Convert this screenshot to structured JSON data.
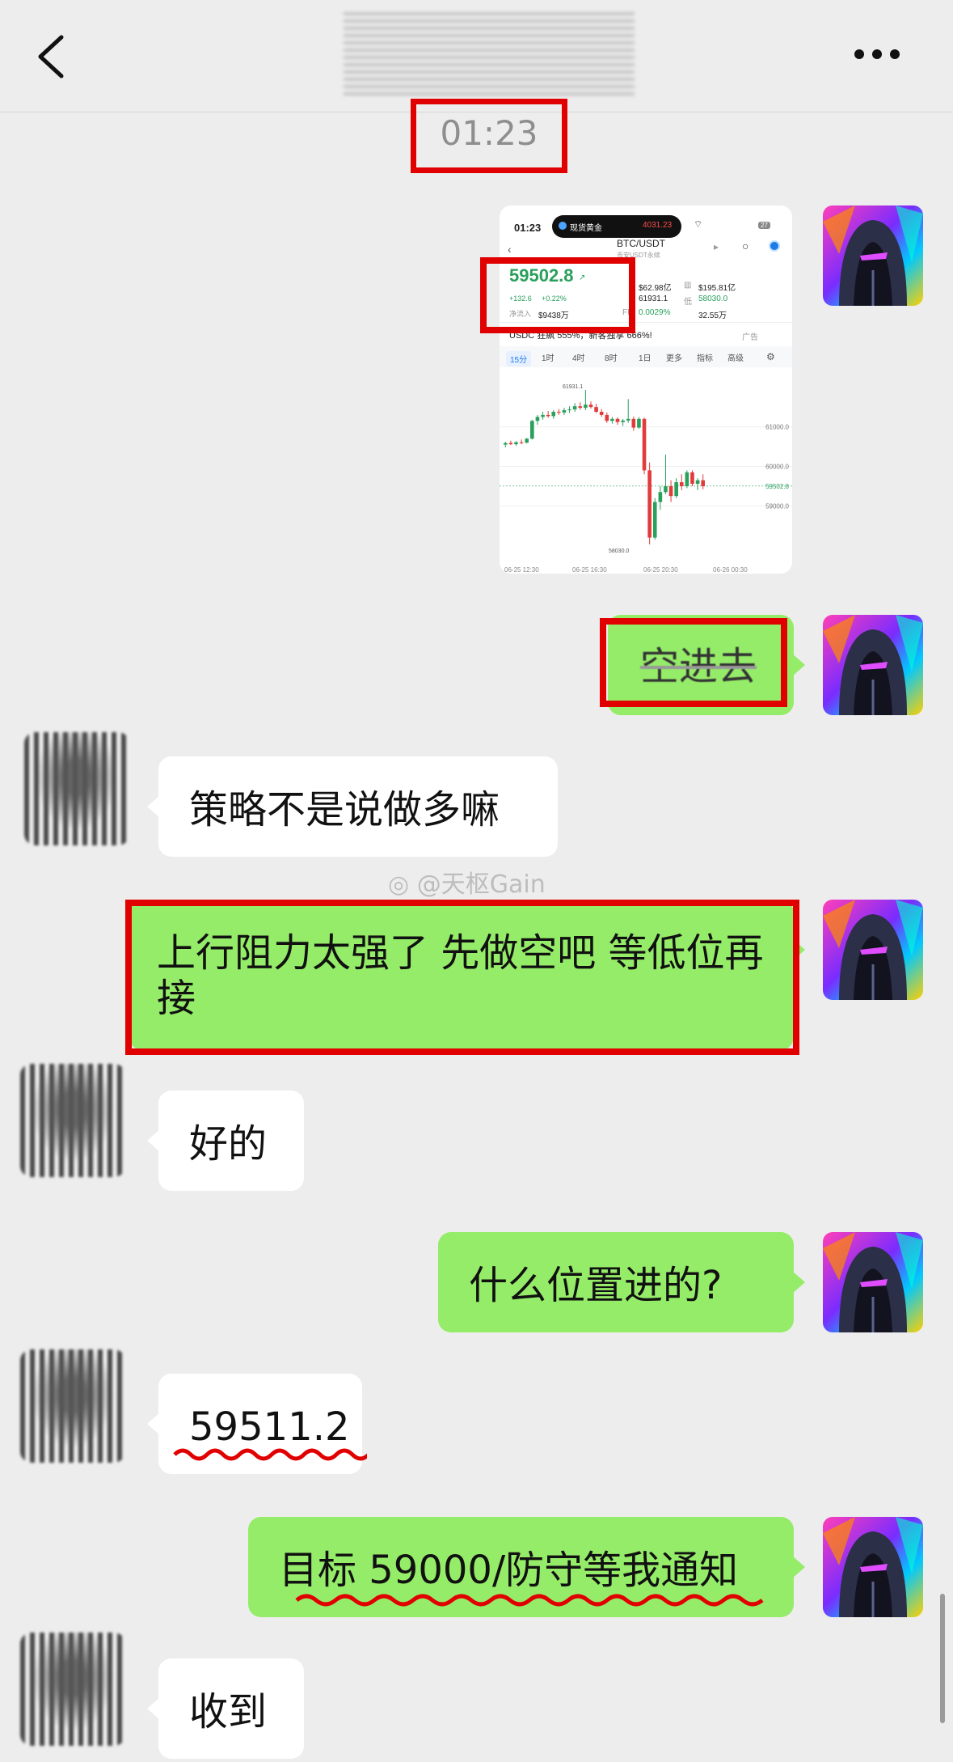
{
  "header": {
    "back_icon": "chevron-left-icon",
    "more_icon": "more-dots-icon"
  },
  "timestamp": "01:23",
  "screenshot": {
    "status_time": "01:23",
    "island_label": "现货黄金",
    "island_value": "4031.23",
    "battery": "27",
    "pair": "BTC/USDT",
    "pair_sub": "币安USDT永续",
    "price": "59502.8",
    "change_abs": "+132.6",
    "change_pct": "+0.22%",
    "stats": [
      {
        "label": "",
        "value": "$62.98亿"
      },
      {
        "label": "",
        "value": "$195.81亿"
      },
      {
        "label": "",
        "value": "61931.1"
      },
      {
        "label": "低",
        "value": "58030.0"
      },
      {
        "label": "净流入",
        "value": "$9438万"
      },
      {
        "label": "FR",
        "value": "0.0029%"
      },
      {
        "label": "",
        "value": "32.55万"
      }
    ],
    "ad_text": "USDC 狂飙 555%，新客独享 666%!",
    "ad_tag": "广告",
    "tabs": [
      "15分",
      "1时",
      "4时",
      "8时",
      "1日",
      "更多",
      "指标",
      "高级"
    ],
    "high_label": "61931.1",
    "low_label": "58030.0",
    "y_ticks": [
      "61000.0",
      "60000.0",
      "59502.8",
      "59000.0"
    ],
    "x_ticks": [
      "06-25 12:30",
      "06-25 16:30",
      "06-25 20:30",
      "06-26 00:30"
    ],
    "candles": [
      [
        60550,
        60620,
        60480,
        60590
      ],
      [
        60590,
        60650,
        60540,
        60560
      ],
      [
        60560,
        60640,
        60520,
        60610
      ],
      [
        60610,
        60680,
        60560,
        60600
      ],
      [
        60600,
        60720,
        60580,
        60700
      ],
      [
        60700,
        61180,
        60680,
        61150
      ],
      [
        61150,
        61300,
        61050,
        61250
      ],
      [
        61250,
        61380,
        61180,
        61300
      ],
      [
        61300,
        61400,
        61230,
        61270
      ],
      [
        61270,
        61420,
        61200,
        61380
      ],
      [
        61380,
        61450,
        61300,
        61360
      ],
      [
        61360,
        61480,
        61300,
        61420
      ],
      [
        61420,
        61520,
        61350,
        61440
      ],
      [
        61440,
        61600,
        61380,
        61520
      ],
      [
        61520,
        61620,
        61430,
        61480
      ],
      [
        61480,
        61931,
        61420,
        61560
      ],
      [
        61560,
        61640,
        61460,
        61500
      ],
      [
        61500,
        61580,
        61350,
        61380
      ],
      [
        61380,
        61450,
        61250,
        61300
      ],
      [
        61300,
        61360,
        61100,
        61150
      ],
      [
        61150,
        61250,
        61080,
        61200
      ],
      [
        61200,
        61240,
        61050,
        61120
      ],
      [
        61120,
        61200,
        61020,
        61160
      ],
      [
        61160,
        61700,
        61100,
        61200
      ],
      [
        61200,
        61260,
        60900,
        60980
      ],
      [
        60980,
        61250,
        60950,
        61200
      ],
      [
        61200,
        61230,
        59800,
        59900
      ],
      [
        59900,
        60100,
        58030,
        58200
      ],
      [
        58200,
        59200,
        58150,
        59100
      ],
      [
        59100,
        59500,
        58900,
        59350
      ],
      [
        59350,
        60300,
        59300,
        59500
      ],
      [
        59500,
        59650,
        59100,
        59250
      ],
      [
        59250,
        59700,
        59200,
        59600
      ],
      [
        59600,
        59800,
        59400,
        59500
      ],
      [
        59500,
        59900,
        59450,
        59850
      ],
      [
        59850,
        59900,
        59500,
        59560
      ],
      [
        59560,
        59700,
        59400,
        59650
      ],
      [
        59650,
        59800,
        59420,
        59502
      ]
    ]
  },
  "messages": [
    {
      "side": "right",
      "text": "空进去"
    },
    {
      "side": "left",
      "text": "策略不是说做多嘛"
    },
    {
      "side": "right",
      "text": "上行阻力太强了 先做空吧 等低位再接"
    },
    {
      "side": "left",
      "text": "好的"
    },
    {
      "side": "right",
      "text": "什么位置进的?"
    },
    {
      "side": "left",
      "text": "59511.2"
    },
    {
      "side": "right",
      "text": "目标 59000/防守等我通知"
    },
    {
      "side": "left",
      "text": "收到"
    }
  ],
  "watermark": "@天枢Gain",
  "colors": {
    "bubble_green": "#95ec69",
    "highlight_red": "#e10000",
    "up": "#2aa05c",
    "down": "#e23b3b"
  }
}
